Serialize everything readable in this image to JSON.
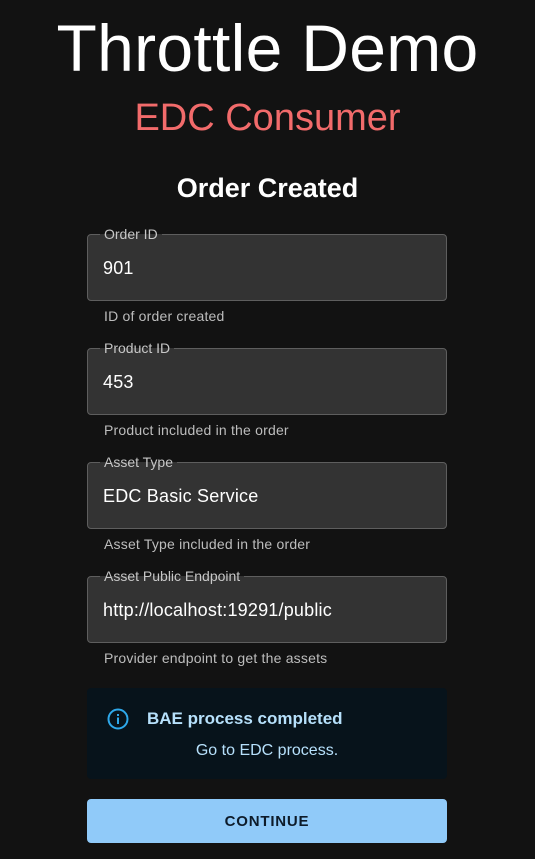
{
  "header": {
    "title": "Throttle Demo",
    "subtitle": "EDC Consumer"
  },
  "section": {
    "title": "Order Created"
  },
  "fields": [
    {
      "label": "Order ID",
      "value": "901",
      "helper": "ID of order created"
    },
    {
      "label": "Product ID",
      "value": "453",
      "helper": "Product included in the order"
    },
    {
      "label": "Asset Type",
      "value": "EDC Basic Service",
      "helper": "Asset Type included in the order"
    },
    {
      "label": "Asset Public Endpoint",
      "value": "http://localhost:19291/public",
      "helper": "Provider endpoint to get the assets"
    }
  ],
  "alert": {
    "icon": "info-icon",
    "title": "BAE process completed",
    "message": "Go to EDC process."
  },
  "actions": {
    "continue_label": "CONTINUE"
  },
  "colors": {
    "background": "#121212",
    "subtitle": "#f26b6b",
    "field_bg": "#333333",
    "alert_bg": "#07131b",
    "alert_text": "#b6e0fb",
    "button_bg": "#90caf9"
  }
}
